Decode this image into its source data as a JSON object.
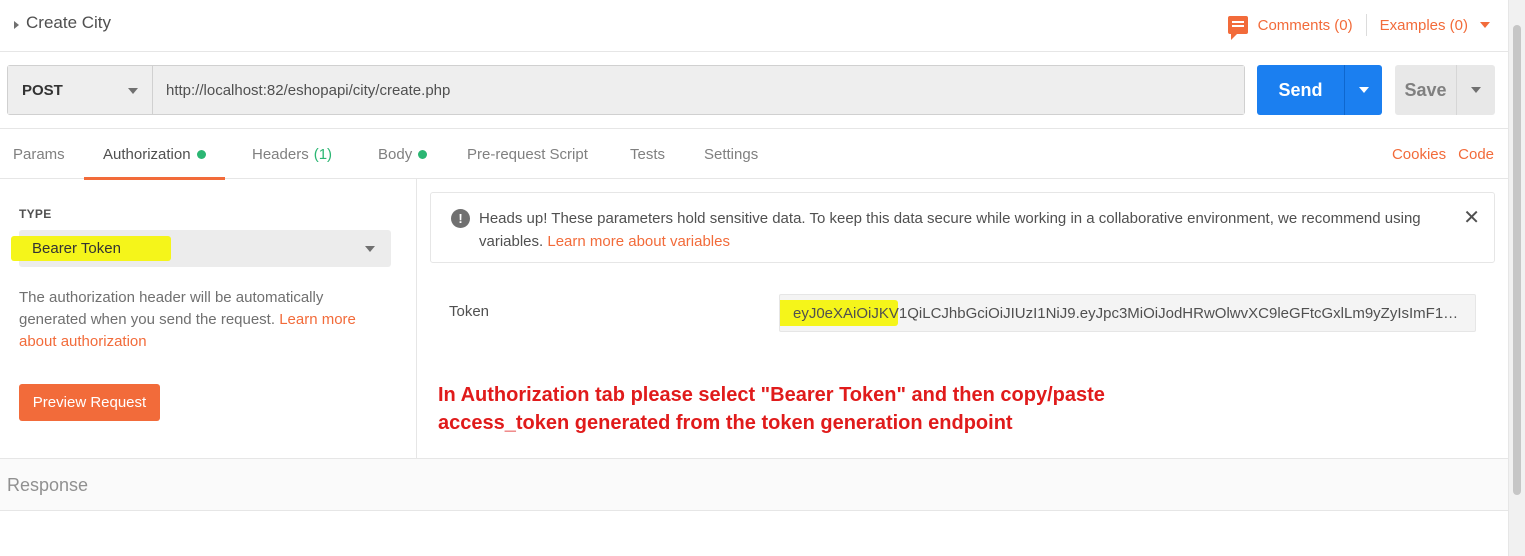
{
  "request": {
    "title": "Create City"
  },
  "header_actions": {
    "comments": "Comments (0)",
    "examples": "Examples (0)"
  },
  "url_bar": {
    "method": "POST",
    "url": "http://localhost:82/eshopapi/city/create.php",
    "send_label": "Send",
    "save_label": "Save"
  },
  "tabs": [
    {
      "label": "Params"
    },
    {
      "label": "Authorization",
      "active": true,
      "dot": true
    },
    {
      "label": "Headers",
      "count": "(1)"
    },
    {
      "label": "Body",
      "dot": true
    },
    {
      "label": "Pre-request Script"
    },
    {
      "label": "Tests"
    },
    {
      "label": "Settings"
    }
  ],
  "tab_links": {
    "cookies": "Cookies",
    "code": "Code"
  },
  "auth": {
    "type_label": "TYPE",
    "type_value": "Bearer Token",
    "desc_text": "The authorization header will be automatically generated when you send the request. ",
    "desc_link": "Learn more about authorization",
    "preview_button": "Preview Request"
  },
  "alert": {
    "text": "Heads up! These parameters hold sensitive data. To keep this data secure while working in a collaborative environment, we recommend using variables. ",
    "link": "Learn more about variables",
    "icon": "exclamation-circle-icon"
  },
  "token": {
    "label": "Token",
    "value": "eyJ0eXAiOiJKV1QiLCJhbGciOiJIUzI1NiJ9.eyJpc3MiOiJodHRwOlwvXC9leGFtcGxlLm9yZyIsImF1ZCI6ImF1..."
  },
  "annotation": {
    "line1": "In Authorization tab please select \"Bearer Token\" and then copy/paste",
    "line2": "access_token generated from the token generation endpoint"
  },
  "response": {
    "label": "Response"
  },
  "colors": {
    "accent": "#f26b3a",
    "primary": "#1b7ff0",
    "success": "#2bb673",
    "highlight": "#f5f51a",
    "annotation": "#e01b1b"
  }
}
